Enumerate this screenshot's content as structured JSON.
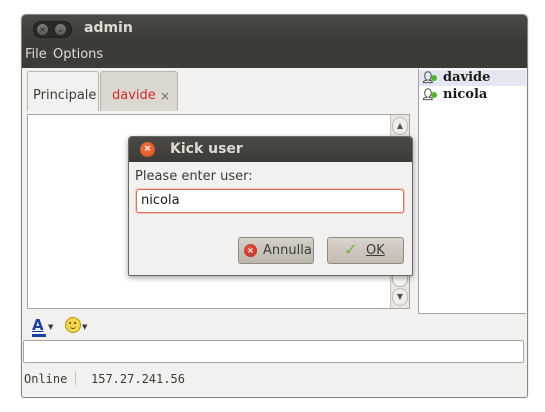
{
  "window": {
    "title": "admin"
  },
  "menu": {
    "items": [
      "File",
      "Options"
    ]
  },
  "tabs": [
    {
      "label": "Principale",
      "active": true
    },
    {
      "label": "davide",
      "closable": true,
      "close_glyph": "×",
      "color": "#cc2b2b"
    }
  ],
  "users": [
    {
      "name": "davide",
      "status": "online",
      "selected": true
    },
    {
      "name": "nicola",
      "status": "online",
      "selected": false
    }
  ],
  "toolbar": {
    "font_color_glyph": "A",
    "font_color": "#1a3fa3"
  },
  "status": {
    "state": "Online",
    "ip": "157.27.241.56"
  },
  "dialog": {
    "title": "Kick user",
    "prompt": "Please enter user:",
    "input_value": "nicola",
    "cancel_label": "Annulla",
    "ok_label": "OK"
  }
}
